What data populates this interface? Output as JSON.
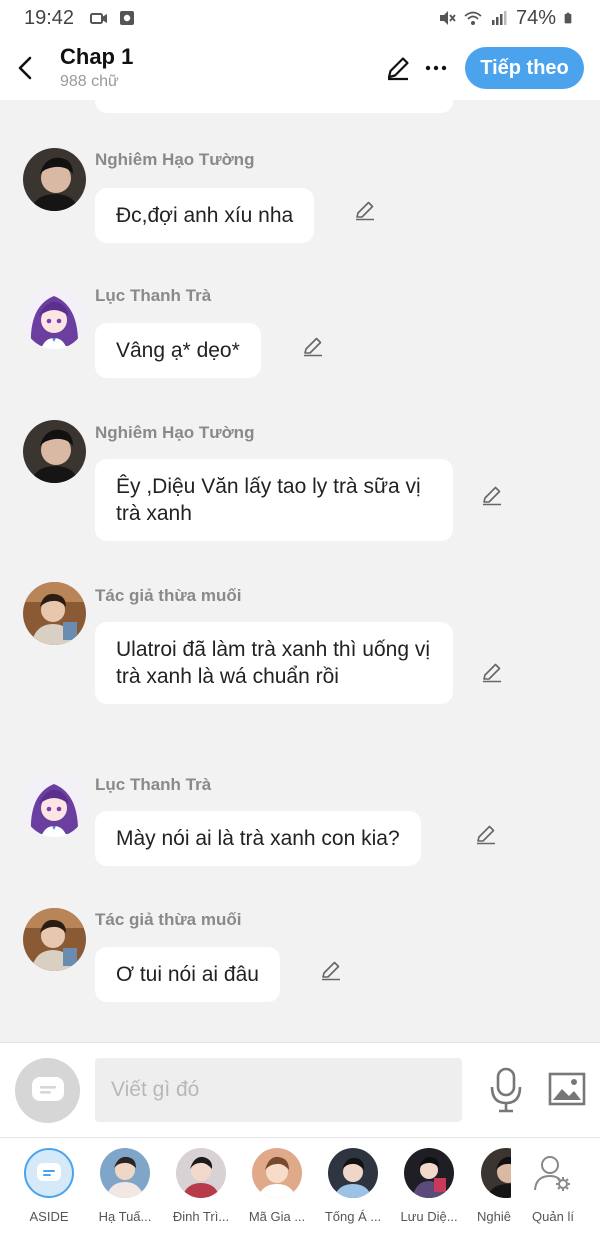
{
  "status_bar": {
    "time": "19:42",
    "battery": "74%"
  },
  "header": {
    "title": "Chap 1",
    "subtitle": "988 chữ",
    "next_label": "Tiếp theo"
  },
  "messages": [
    {
      "sender": "Nghiêm Hạo Tường",
      "text": "Đc,đợi anh xíu nha",
      "avatar": "boy-dark"
    },
    {
      "sender": "Lục Thanh Trà",
      "text": "Vâng ạ* dẹo*",
      "avatar": "anime-girl"
    },
    {
      "sender": "Nghiêm Hạo Tường",
      "text": "Êy ,Diệu Văn lấy tao ly trà sữa vị trà xanh",
      "avatar": "boy-dark"
    },
    {
      "sender": "Tác giả thừa muối",
      "text": "Ulatroi đã làm trà xanh thì uống vị trà xanh là wá chuẩn rồi",
      "avatar": "boy-brown"
    },
    {
      "sender": "Lục Thanh Trà",
      "text": "Mày nói ai là trà xanh con kia?",
      "avatar": "anime-girl"
    },
    {
      "sender": "Tác giả thừa muối",
      "text": "Ơ tui nói ai đâu",
      "avatar": "boy-brown"
    }
  ],
  "input": {
    "placeholder": "Viết gì đó"
  },
  "characters": [
    {
      "name": "ASIDE"
    },
    {
      "name": "Hạ Tuấ..."
    },
    {
      "name": "Đinh Trì..."
    },
    {
      "name": "Mã Gia ..."
    },
    {
      "name": "Tống Á ..."
    },
    {
      "name": "Lưu Diệ..."
    },
    {
      "name": "Nghiê"
    },
    {
      "name": "Quản lí"
    }
  ],
  "colors": {
    "accent": "#4aa3ec",
    "background": "#f2f2f2",
    "bubble": "#ffffff"
  }
}
